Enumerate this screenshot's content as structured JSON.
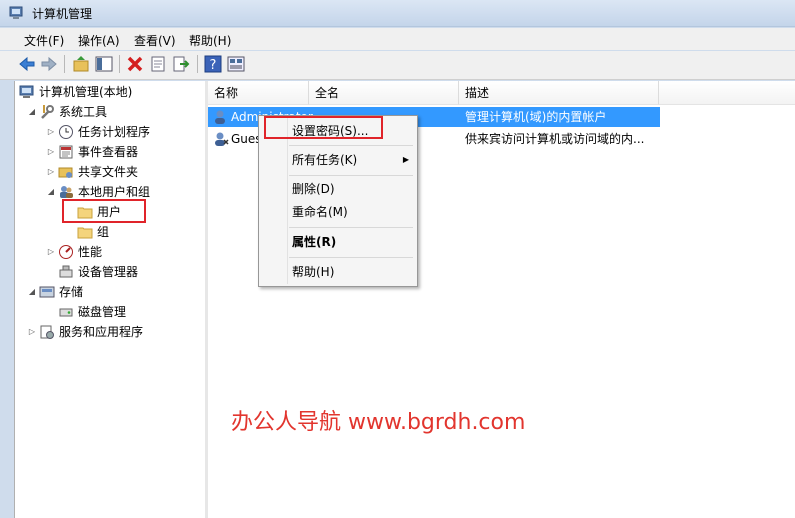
{
  "window": {
    "title": "计算机管理"
  },
  "menu": {
    "file": "文件(F)",
    "action": "操作(A)",
    "view": "查看(V)",
    "help": "帮助(H)"
  },
  "toolbar": {
    "icons": [
      "back-arrow-icon",
      "forward-arrow-icon",
      "up-folder-icon",
      "show-tree-icon",
      "delete-icon",
      "properties-icon",
      "export-icon",
      "help-icon",
      "view-icon"
    ]
  },
  "tree": {
    "root": "计算机管理(本地)",
    "system_tools": "系统工具",
    "task_scheduler": "任务计划程序",
    "event_viewer": "事件查看器",
    "shared_folders": "共享文件夹",
    "local_users_groups": "本地用户和组",
    "users": "用户",
    "groups": "组",
    "performance": "性能",
    "device_manager": "设备管理器",
    "storage": "存储",
    "disk_management": "磁盘管理",
    "services_apps": "服务和应用程序"
  },
  "list": {
    "columns": {
      "name": "名称",
      "fullname": "全名",
      "description": "描述"
    },
    "rows": [
      {
        "name": "Administrator",
        "description": "管理计算机(域)的内置帐户"
      },
      {
        "name": "Guest",
        "description": "供来宾访问计算机或访问域的内..."
      }
    ]
  },
  "context_menu": {
    "set_password": "设置密码(S)...",
    "all_tasks": "所有任务(K)",
    "delete": "删除(D)",
    "rename": "重命名(M)",
    "properties": "属性(R)",
    "help": "帮助(H)"
  },
  "watermark": "办公人导航 www.bgrdh.com",
  "colors": {
    "selection": "#3399ff",
    "highlight_box": "#e0242a",
    "watermark": "#e2352e"
  }
}
